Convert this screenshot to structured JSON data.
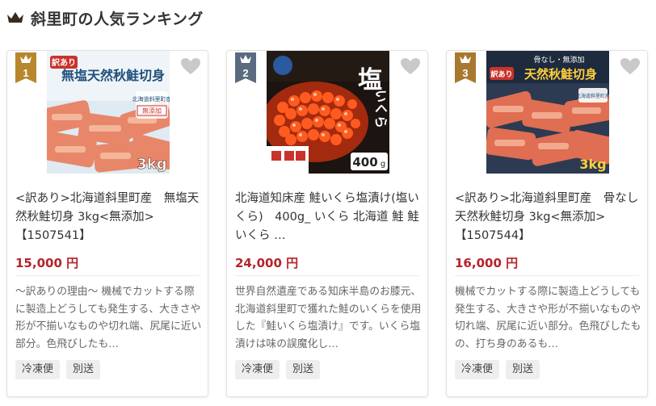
{
  "header": {
    "title": "斜里町の人気ランキング",
    "icon": "crown-icon"
  },
  "colors": {
    "gold": "#b8862c",
    "silver": "#5a6b80",
    "bronze": "#a8782f",
    "price": "#b6232a"
  },
  "cards": [
    {
      "rank": "1",
      "name": "<訳あり>北海道斜里町産　無塩天然秋鮭切身 3kg<無添加>【1507541】",
      "price": "15,000 円",
      "desc": "～訳ありの理由～ 機械でカットする際に製造上どうしても発生する、大きさや形が不揃いなものや切れ端、尻尾に近い部分。色飛びしたも…",
      "tags": [
        "冷凍便",
        "別送"
      ],
      "image_text": {
        "badge": "訳あり",
        "title": "無塩天然秋鮭切身",
        "weight": "3kg",
        "side1": "北海道斜里町産",
        "side2": "無添加"
      }
    },
    {
      "rank": "2",
      "name": "北海道知床産 鮭いくら塩漬け(塩いくら)　400g_ いくら 北海道 鮭 鮭いくら …",
      "price": "24,000 円",
      "desc": "世界自然遺産である知床半島のお膝元、北海道斜里町で獲れた鮭のいくらを使用した『鮭いくら塩漬け』です。いくら塩漬けは味の誤魔化し…",
      "tags": [
        "冷凍便",
        "別送"
      ],
      "image_text": {
        "title1": "塩",
        "title2": "いくら",
        "weight": "400",
        "unit": "g"
      }
    },
    {
      "rank": "3",
      "name": "<訳あり>北海道斜里町産　骨なし天然秋鮭切身 3kg<無添加>【1507544】",
      "price": "16,000 円",
      "desc": "機械でカットする際に製造上どうしても発生する、大きさや形が不揃いなものや切れ端、尻尾に近い部分。色飛びしたもの、打ち身のあるも…",
      "tags": [
        "冷凍便",
        "別送"
      ],
      "image_text": {
        "top": "骨なし・無添加",
        "badge": "訳あり",
        "title": "天然秋鮭切身",
        "weight": "3kg",
        "side1": "北海道斜里町産"
      }
    }
  ]
}
